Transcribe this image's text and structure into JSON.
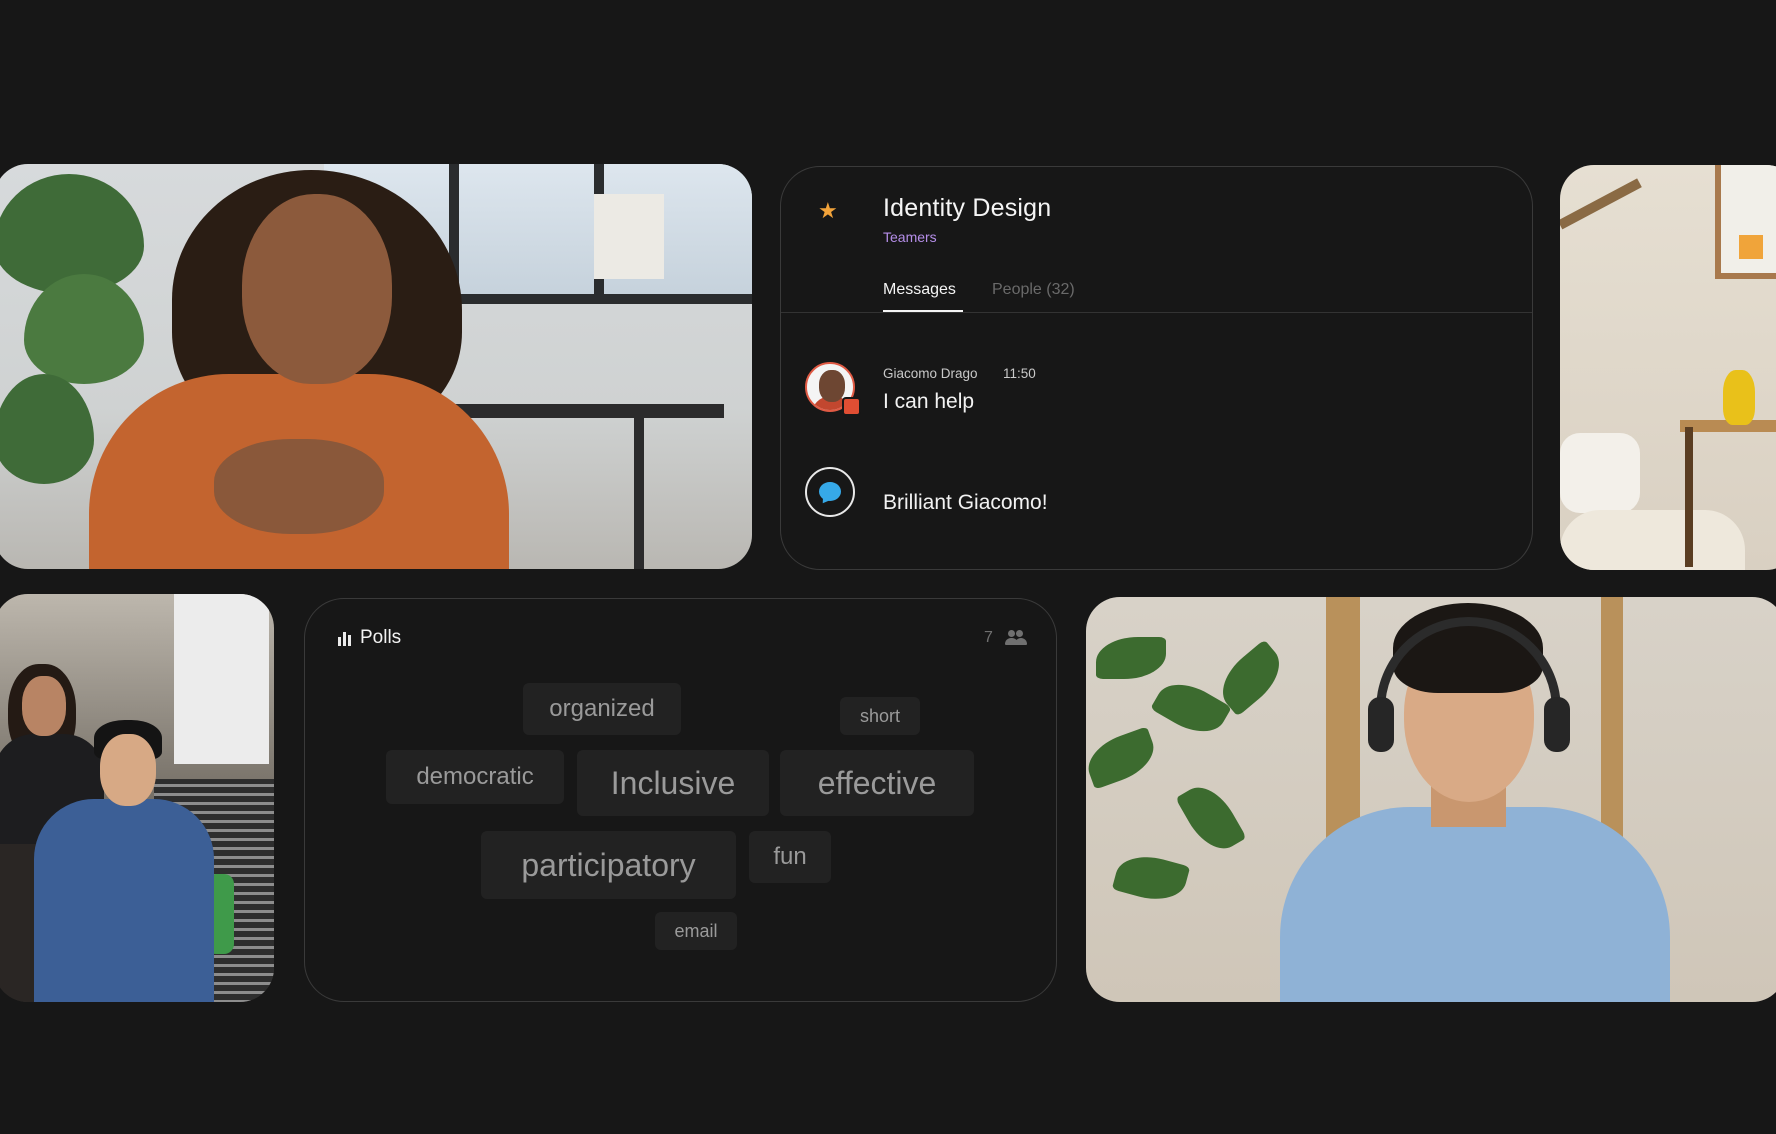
{
  "chat_panel": {
    "title": "Identity Design",
    "subtitle": "Teamers",
    "tabs": [
      {
        "label": "Messages",
        "active": true
      },
      {
        "label": "People (32)",
        "active": false
      }
    ],
    "messages": [
      {
        "sender": "Giacomo Drago",
        "time": "11:50",
        "text": "I can help"
      },
      {
        "text": "Brilliant Giacomo!"
      }
    ],
    "icons": [
      "star-icon",
      "chat-bubble-icon"
    ]
  },
  "polls_panel": {
    "title": "Polls",
    "participant_count": "7",
    "words": [
      "organized",
      "short",
      "democratic",
      "Inclusive",
      "effective",
      "participatory",
      "fun",
      "email"
    ],
    "icons": [
      "bar-chart-icon",
      "people-icon"
    ]
  },
  "colors": {
    "background": "#171717",
    "accent_star": "#f2a33a",
    "subtitle_purple": "#b58ee8",
    "chat_bubble_blue": "#36a9e8",
    "badge_red": "#e04e33"
  }
}
